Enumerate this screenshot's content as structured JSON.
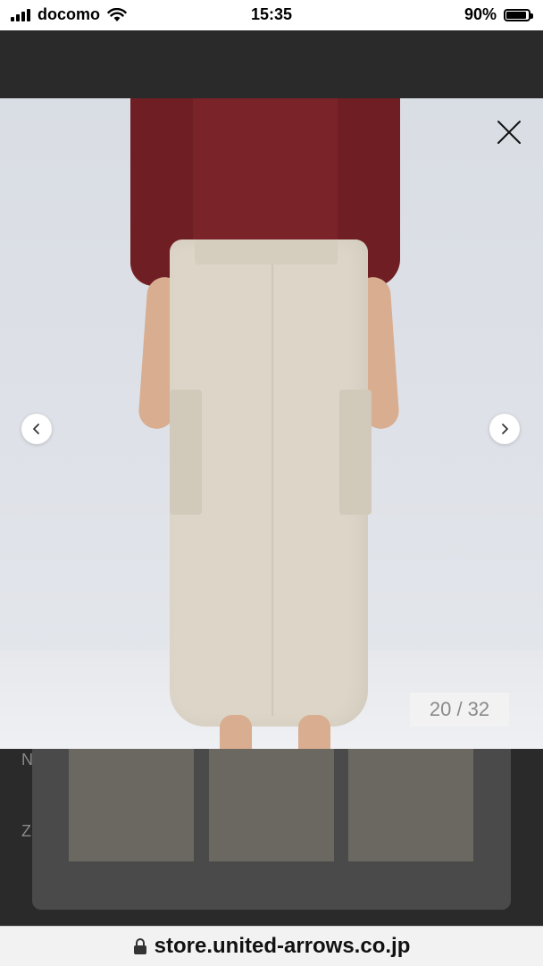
{
  "status_bar": {
    "carrier": "docomo",
    "time": "15:35",
    "battery_percent": "90%",
    "battery_level": 0.9,
    "signal_icon": "signal-bars-icon",
    "wifi_icon": "wifi-icon"
  },
  "viewer": {
    "counter": "20 / 32",
    "close_icon": "close-icon",
    "prev_icon": "chevron-left-icon",
    "next_icon": "chevron-right-icon"
  },
  "background_page": {
    "partial_letters": [
      "N",
      "Z"
    ]
  },
  "browser": {
    "url": "store.united-arrows.co.jp",
    "lock_icon": "lock-icon"
  },
  "colors": {
    "shirt": "#7a2328",
    "pants": "#ddd6c8",
    "background": "#2b2b2b"
  }
}
